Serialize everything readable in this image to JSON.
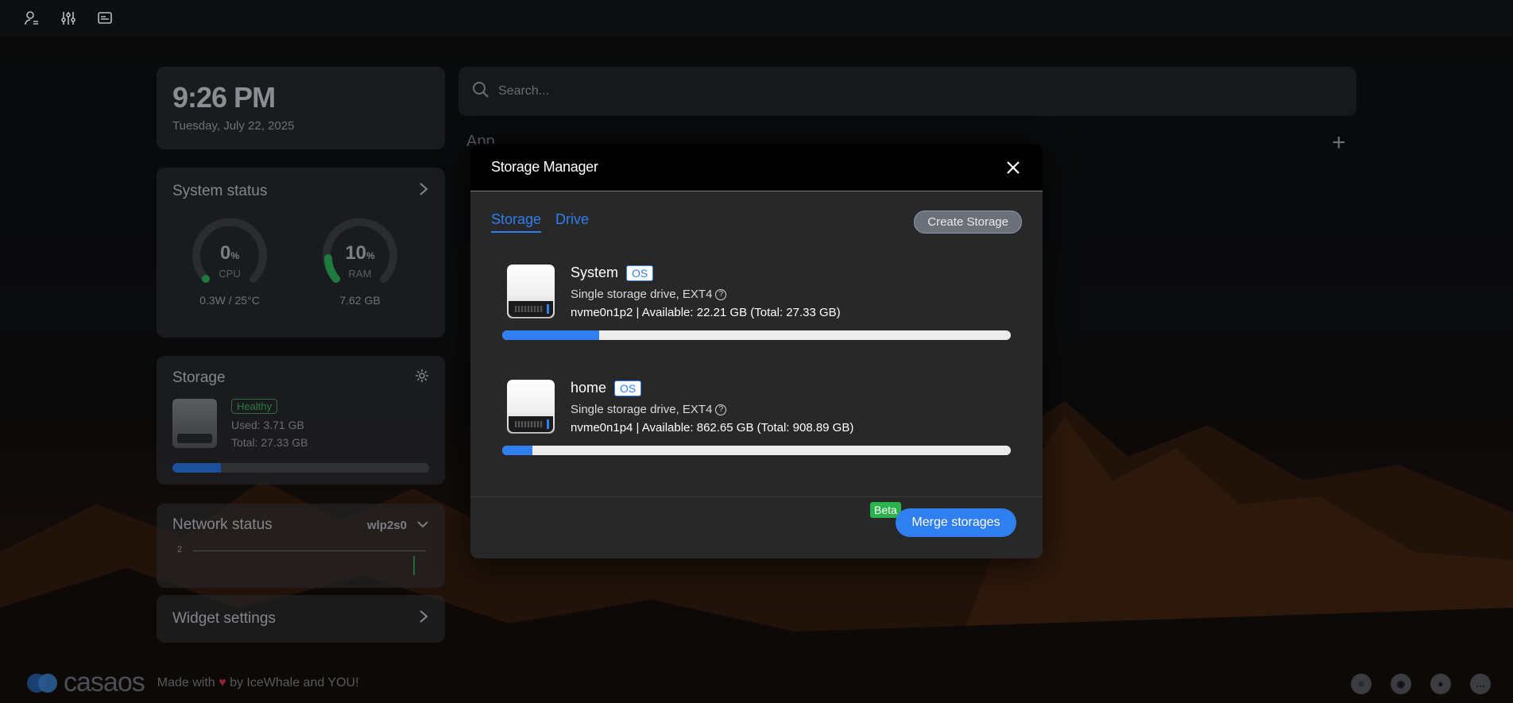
{
  "dashboard": {
    "time": "9:26 PM",
    "date": "Tuesday, July 22, 2025",
    "system_status": {
      "title": "System status",
      "cpu": {
        "value": "0",
        "unit": "%",
        "label": "CPU",
        "sub": "0.3W / 25°C",
        "percent": 0
      },
      "ram": {
        "value": "10",
        "unit": "%",
        "label": "RAM",
        "sub": "7.62 GB",
        "percent": 10
      }
    },
    "storage": {
      "title": "Storage",
      "health": "Healthy",
      "used": "Used: 3.71 GB",
      "total": "Total: 27.33 GB",
      "usage_fraction": 0.19
    },
    "network": {
      "title": "Network status",
      "interface": "wlp2s0",
      "axis_label": "2"
    },
    "widget_settings": "Widget settings",
    "search_placeholder": "Search...",
    "app_title": "App"
  },
  "footer": {
    "logo": "casaos",
    "made_prefix": "Made with",
    "heart": "♥",
    "made_suffix": "by IceWhale and YOU!"
  },
  "modal": {
    "title": "Storage Manager",
    "tabs": [
      {
        "label": "Storage",
        "active": true
      },
      {
        "label": "Drive",
        "active": false
      }
    ],
    "create_button": "Create Storage",
    "items": [
      {
        "name": "System",
        "badge": "OS",
        "description": "Single storage drive, EXT4",
        "detail": "nvme0n1p2 | Available: 22.21 GB (Total: 27.33 GB)",
        "usage_fraction": 0.19
      },
      {
        "name": "home",
        "badge": "OS",
        "description": "Single storage drive, EXT4",
        "detail": "nvme0n1p4 | Available: 862.65 GB (Total: 908.89 GB)",
        "usage_fraction": 0.06
      }
    ],
    "beta_label": "Beta",
    "merge_button": "Merge storages"
  },
  "colors": {
    "accent": "#2f7ff0",
    "beta": "#2bb24c",
    "modal_bg": "#282828",
    "header_bg": "#000000"
  }
}
